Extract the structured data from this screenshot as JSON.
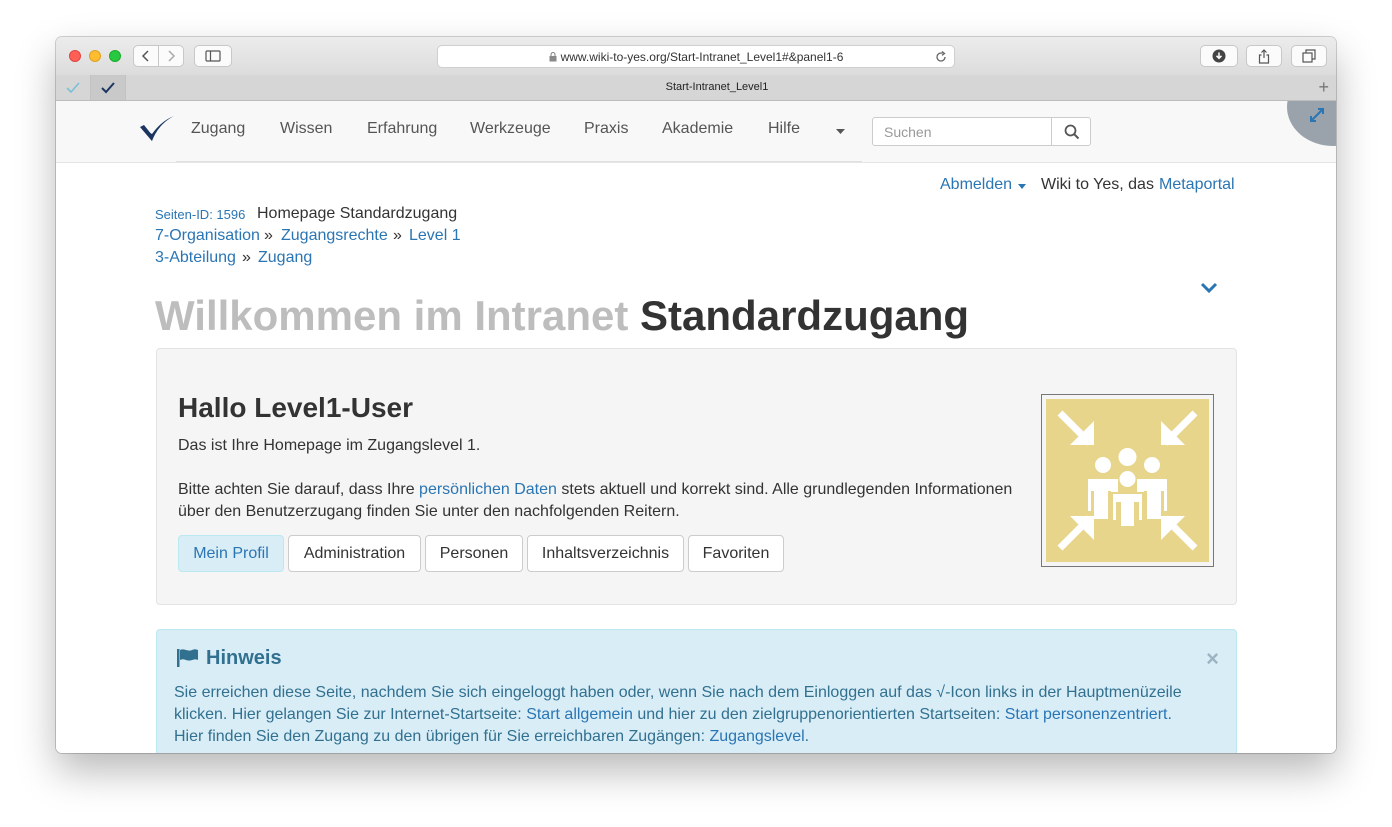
{
  "browser": {
    "url": "www.wiki-to-yes.org/Start-Intranet_Level1#&panel1-6",
    "tab_title": "Start-Intranet_Level1",
    "new_tab_symbol": "+"
  },
  "nav": {
    "items": [
      {
        "label": "Zugang"
      },
      {
        "label": "Wissen"
      },
      {
        "label": "Erfahrung"
      },
      {
        "label": "Werkzeuge"
      },
      {
        "label": "Praxis"
      },
      {
        "label": "Akademie"
      },
      {
        "label": "Hilfe"
      }
    ],
    "search_placeholder": "Suchen"
  },
  "user_bar": {
    "logout": "Abmelden",
    "site_text": "Wiki to Yes, das",
    "portal_link": "Metaportal"
  },
  "page_info": {
    "id_label": "Seiten-ID: 1596",
    "page_name": "Homepage Standardzugang"
  },
  "breadcrumbs": {
    "row1": [
      "7-Organisation",
      "Zugangsrechte",
      "Level 1"
    ],
    "row2": [
      "3-Abteilung",
      "Zugang"
    ],
    "separator": "»"
  },
  "title": {
    "light": "Willkommen im Intranet",
    "bold": "Standardzugang"
  },
  "welcome": {
    "heading": "Hallo Level1-User",
    "intro": "Das ist Ihre Homepage im Zugangslevel 1.",
    "text_before": "Bitte achten Sie darauf, dass Ihre",
    "text_link": "persönlichen Daten",
    "text_after": "stets aktuell und korrekt sind. Alle grundlegenden Informationen",
    "text_line2": "über den Benutzerzugang finden Sie unter den nachfolgenden Reitern.",
    "tabs": [
      {
        "label": "Mein Profil",
        "active": true
      },
      {
        "label": "Administration",
        "active": false
      },
      {
        "label": "Personen",
        "active": false
      },
      {
        "label": "Inhaltsverzeichnis",
        "active": false
      },
      {
        "label": "Favoriten",
        "active": false
      }
    ],
    "image_icon": "assembly-point-icon"
  },
  "notice": {
    "title": "Hinweis",
    "close": "×",
    "line1": "Sie erreichen diese Seite, nachdem Sie sich eingeloggt haben oder, wenn Sie nach dem Einloggen auf das √-Icon links in der Hauptmenüzeile",
    "line2_a": "klicken. Hier gelangen Sie zur Internet-Startseite:",
    "line2_link1": "Start allgemein",
    "line2_b": "und hier zu den zielgruppenorientierten Startseiten:",
    "line2_link2": "Start personenzentriert",
    "line2_end": ".",
    "line3_a": "Hier finden Sie den Zugang zu den übrigen für Sie erreichbaren Zugängen:",
    "line3_link": "Zugangslevel",
    "line3_end": "."
  },
  "colors": {
    "link": "#2a75b3",
    "logo": "#1b3560",
    "info_bg": "#d9edf7",
    "info_text": "#31708f",
    "image_bg": "#e8d58c"
  }
}
